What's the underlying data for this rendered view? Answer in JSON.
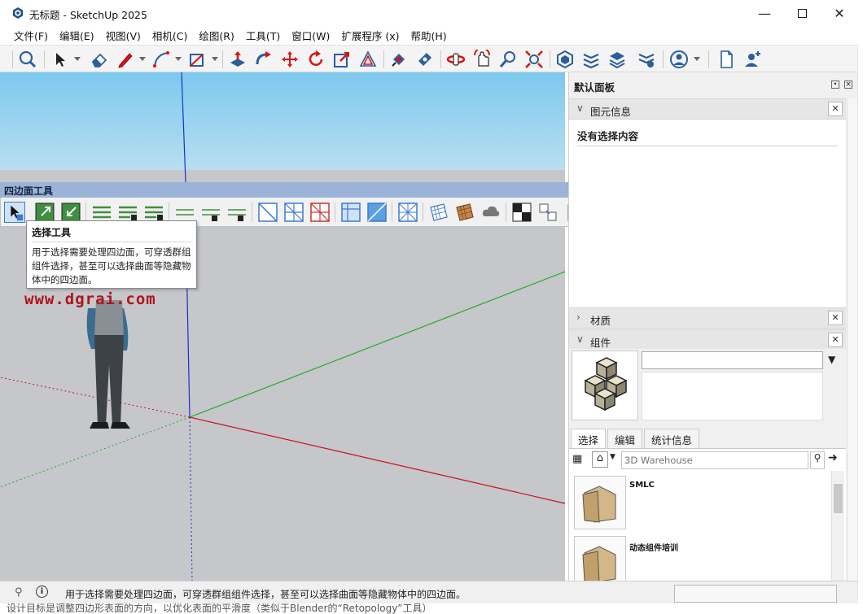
{
  "window": {
    "title": "无标题 - SketchUp 2025",
    "minimize_icon": "minimize-icon",
    "maximize_icon": "maximize-icon",
    "close_icon": "close-icon"
  },
  "menubar": {
    "items": [
      "文件(F)",
      "编辑(E)",
      "视图(V)",
      "相机(C)",
      "绘图(R)",
      "工具(T)",
      "窗口(W)",
      "扩展程序 (x)",
      "帮助(H)"
    ]
  },
  "toolbar": {
    "icons": [
      "search-icon",
      "select-arrow-icon",
      "eraser-icon",
      "pencil-line-icon",
      "arc-icon",
      "rectangle-icon",
      "push-pull-icon",
      "follow-me-icon",
      "move-icon",
      "rotate-icon",
      "scale-icon",
      "offset-icon",
      "paint-bucket-icon",
      "tape-measure-icon",
      "orbit-icon",
      "pan-icon",
      "zoom-icon",
      "zoom-extents-icon",
      "warehouse-icon",
      "extension-warehouse-icon",
      "layout-icon",
      "style-builder-icon",
      "account-icon",
      "new-file-icon",
      "add-user-icon"
    ]
  },
  "quad_toolbar": {
    "title": "四边面工具",
    "close": "×"
  },
  "tooltip": {
    "title": "选择工具",
    "body": "用于选择需要处理四边面，可穿透群组组件选择，甚至可以选择曲面等隐藏物体中的四边面。"
  },
  "viewport": {
    "watermark": "www.dgrai.com"
  },
  "tray": {
    "title": "默认面板",
    "entity_info": {
      "header": "图元信息",
      "no_selection": "没有选择内容"
    },
    "materials": {
      "header": "材质"
    },
    "components": {
      "header": "组件",
      "tabs": [
        "选择",
        "编辑",
        "统计信息"
      ],
      "search_placeholder": "3D Warehouse",
      "items": [
        "SMLC",
        "动态组件培训"
      ]
    }
  },
  "statusbar": {
    "text": "用于选择需要处理四边面，可穿透群组组件选择，甚至可以选择曲面等隐藏物体中的四边面。"
  },
  "bottom_strip": {
    "text": "设计目标是调整四边形表面的方向，以优化表面的平滑度（类似于Blender的“Retopology”工具）"
  },
  "colors": {
    "axis_red": "#cc1111",
    "axis_green": "#22aa22",
    "axis_blue": "#1f2ecc",
    "quad_title_bg": "#9ab3d6",
    "watermark": "#b0141b"
  }
}
